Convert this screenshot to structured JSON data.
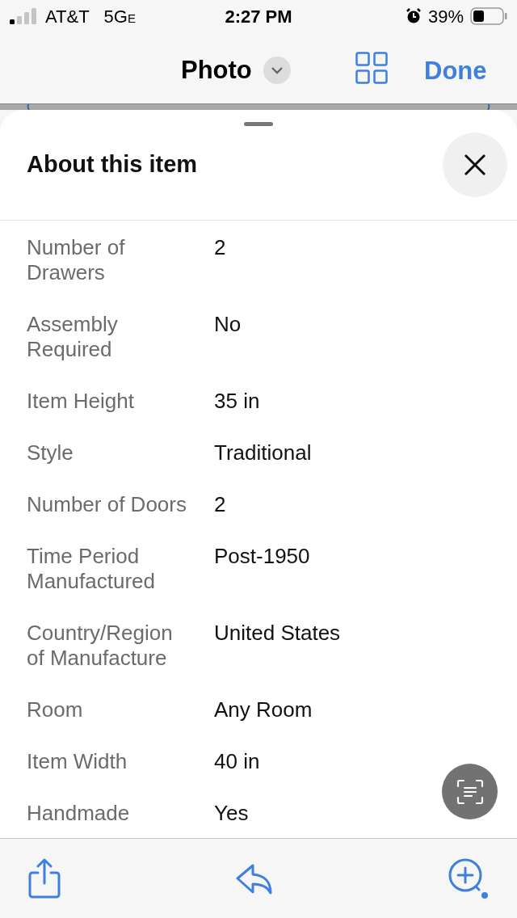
{
  "status_bar": {
    "carrier": "AT&T",
    "network": "5G",
    "network_suffix": "E",
    "time": "2:27 PM",
    "battery": "39%"
  },
  "nav": {
    "title": "Photo",
    "done": "Done"
  },
  "sheet": {
    "title": "About this item",
    "specs": [
      {
        "label": "Number of Drawers",
        "value": "2"
      },
      {
        "label": "Assembly Required",
        "value": "No"
      },
      {
        "label": "Item Height",
        "value": "35 in"
      },
      {
        "label": "Style",
        "value": "Traditional"
      },
      {
        "label": "Number of Doors",
        "value": "2"
      },
      {
        "label": "Time Period Manufactured",
        "value": "Post-1950"
      },
      {
        "label": "Country/Region of Manufacture",
        "value": "United States"
      },
      {
        "label": "Room",
        "value": "Any Room"
      },
      {
        "label": "Item Width",
        "value": "40 in"
      },
      {
        "label": "Handmade",
        "value": "Yes"
      }
    ]
  }
}
